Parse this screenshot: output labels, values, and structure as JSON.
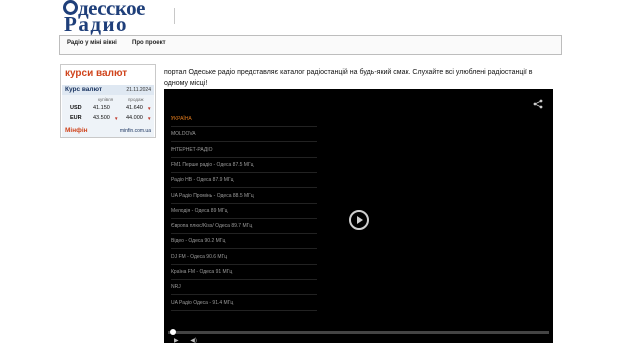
{
  "logo": {
    "line1": "десское",
    "line2": "Радио"
  },
  "nav": {
    "items": [
      "Радіо у міні вікні",
      "Про проект"
    ]
  },
  "sidebar": {
    "title": "курси валют",
    "rates": {
      "title": "Курс валют",
      "date": "21.11.2024",
      "col_buy": "купівля",
      "col_sell": "продаж",
      "rows": [
        {
          "currency": "USD",
          "buy": "41.150",
          "sell": "41.640",
          "sell_arrow": "▼"
        },
        {
          "currency": "EUR",
          "buy": "43.500",
          "buy_arrow": "▼",
          "sell": "44.000",
          "sell_arrow": "▼"
        }
      ],
      "source": "Мінфін",
      "source_url": "minfin.com.ua"
    }
  },
  "intro": "портал Одеське радіо представляє каталог радіостанцій на будь-який смак. Слухайте всі улюблені радіостанції в одному місці!",
  "player": {
    "items": [
      {
        "label": "УКРАЇНА",
        "active": true,
        "chevron": "›"
      },
      {
        "label": "MOLDOVA",
        "chevron": "›"
      },
      {
        "label": "ІНТЕРНЕТ-РАДІО",
        "chevron": "›"
      },
      {
        "label": "FM1 Перше радіо - Одеса 87.5 МГц"
      },
      {
        "label": "Радіо НВ - Одеса 87.9 МГц"
      },
      {
        "label": "UA Радіо Промінь - Одеса 88.5 МГц"
      },
      {
        "label": "Мелодія - Одеса 89 МГц"
      },
      {
        "label": "Європа плюс/Kiss/ Одеса 89.7 МГц"
      },
      {
        "label": "Відео - Одеса 90.2 МГц"
      },
      {
        "label": "DJ FM - Одеса 90.6 МГц"
      },
      {
        "label": "Країна FM - Одеса 91 МГц"
      },
      {
        "label": "NRJ"
      },
      {
        "label": "UA Радіо Одеса - 91.4 МГц"
      }
    ],
    "progress": 0.01
  },
  "colors": {
    "brand": "#1f3f7a",
    "accent": "#d0441c",
    "active_station": "#e07a1c"
  }
}
